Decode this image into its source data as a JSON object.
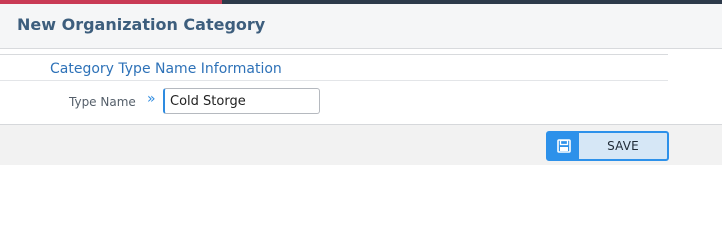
{
  "page": {
    "title": "New Organization Category"
  },
  "section": {
    "title": "Category Type Name Information"
  },
  "form": {
    "type_name_label": "Type Name",
    "type_name_value": "Cold Storge"
  },
  "actions": {
    "save_label": "SAVE",
    "save_icon": "floppy-disk-icon"
  },
  "colors": {
    "title_text": "#3d5e7d",
    "section_title_text": "#2e72b8",
    "accent_blue": "#2d91ea",
    "top_accent_red": "#c93a55"
  }
}
